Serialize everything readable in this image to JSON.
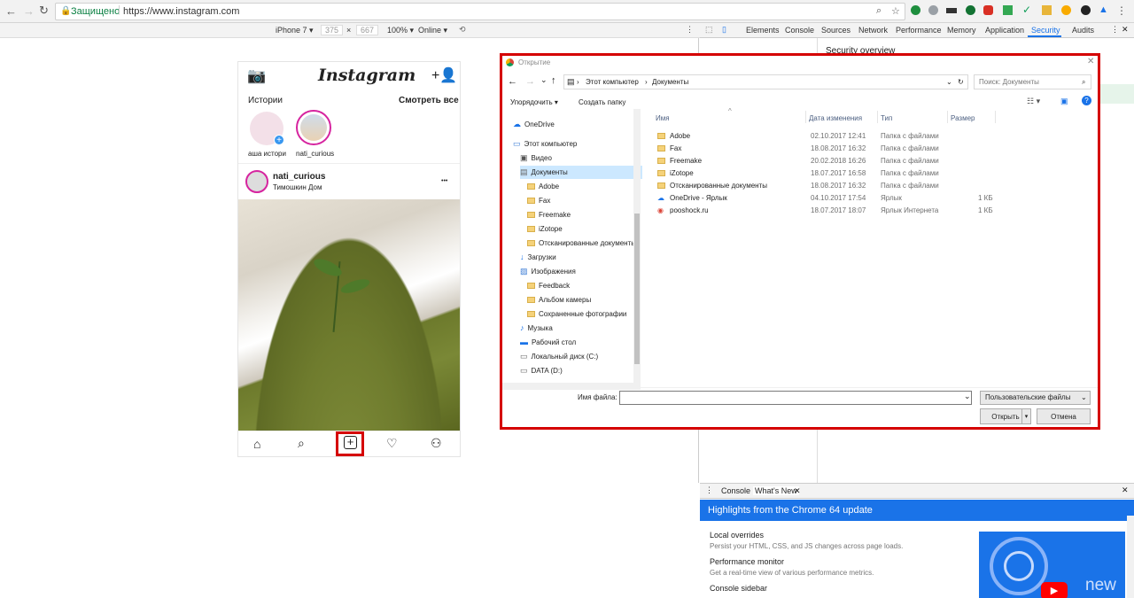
{
  "browser": {
    "secure_label": "Защищено",
    "url": "https://www.instagram.com"
  },
  "device_toolbar": {
    "device": "iPhone 7 ▾",
    "width": "375",
    "times": "×",
    "height": "667",
    "zoom": "100% ▾",
    "network": "Online ▾"
  },
  "devtools": {
    "tabs": [
      "Elements",
      "Console",
      "Sources",
      "Network",
      "Performance",
      "Memory",
      "Application",
      "Security",
      "Audits"
    ],
    "active_tab": "Security",
    "security_overview": "Security overview",
    "drawer_tabs": [
      "Console",
      "What's New"
    ],
    "highlights_title": "Highlights from the Chrome 64 update",
    "items": [
      {
        "title": "Local overrides",
        "desc": "Persist your HTML, CSS, and JS changes across page loads."
      },
      {
        "title": "Performance monitor",
        "desc": "Get a real-time view of various performance metrics."
      },
      {
        "title": "Console sidebar",
        "desc": ""
      }
    ],
    "video_label": "new"
  },
  "instagram": {
    "logo": "Instagram",
    "stories_label": "Истории",
    "watch_all": "Смотреть все",
    "stories": [
      {
        "name": "аша истори"
      },
      {
        "name": "nati_curious"
      }
    ],
    "post_user": "nati_curious",
    "post_location": "Тимошкин Дом",
    "more": "•••"
  },
  "dialog": {
    "title": "Открытие",
    "breadcrumb": [
      "Этот компьютер",
      "Документы"
    ],
    "search_placeholder": "Поиск: Документы",
    "organize": "Упорядочить ▾",
    "new_folder": "Создать папку",
    "columns": {
      "name": "Имя",
      "date": "Дата изменения",
      "type": "Тип",
      "size": "Размер"
    },
    "nav_items": [
      {
        "label": "OneDrive",
        "indent": 0,
        "kind": "cloud"
      },
      {
        "label": "Этот компьютер",
        "indent": 0,
        "kind": "pc"
      },
      {
        "label": "Видео",
        "indent": 1,
        "kind": "video"
      },
      {
        "label": "Документы",
        "indent": 1,
        "kind": "docs",
        "selected": true
      },
      {
        "label": "Adobe",
        "indent": 2,
        "kind": "folder"
      },
      {
        "label": "Fax",
        "indent": 2,
        "kind": "folder"
      },
      {
        "label": "Freemake",
        "indent": 2,
        "kind": "folder"
      },
      {
        "label": "iZotope",
        "indent": 2,
        "kind": "folder"
      },
      {
        "label": "Отсканированные документы",
        "indent": 2,
        "kind": "folder"
      },
      {
        "label": "Загрузки",
        "indent": 1,
        "kind": "down"
      },
      {
        "label": "Изображения",
        "indent": 1,
        "kind": "img"
      },
      {
        "label": "Feedback",
        "indent": 2,
        "kind": "folder"
      },
      {
        "label": "Альбом камеры",
        "indent": 2,
        "kind": "folder"
      },
      {
        "label": "Сохраненные фотографии",
        "indent": 2,
        "kind": "folder"
      },
      {
        "label": "Музыка",
        "indent": 1,
        "kind": "music"
      },
      {
        "label": "Рабочий стол",
        "indent": 1,
        "kind": "desktop"
      },
      {
        "label": "Локальный диск (C:)",
        "indent": 1,
        "kind": "disk"
      },
      {
        "label": "DATA (D:)",
        "indent": 1,
        "kind": "disk"
      }
    ],
    "files": [
      {
        "name": "Adobe",
        "date": "02.10.2017 12:41",
        "type": "Папка с файлами",
        "size": "",
        "kind": "folder"
      },
      {
        "name": "Fax",
        "date": "18.08.2017 16:32",
        "type": "Папка с файлами",
        "size": "",
        "kind": "folder"
      },
      {
        "name": "Freemake",
        "date": "20.02.2018 16:26",
        "type": "Папка с файлами",
        "size": "",
        "kind": "folder"
      },
      {
        "name": "iZotope",
        "date": "18.07.2017 16:58",
        "type": "Папка с файлами",
        "size": "",
        "kind": "folder"
      },
      {
        "name": "Отсканированные документы",
        "date": "18.08.2017 16:32",
        "type": "Папка с файлами",
        "size": "",
        "kind": "folder"
      },
      {
        "name": "OneDrive - Ярлык",
        "date": "04.10.2017 17:54",
        "type": "Ярлык",
        "size": "1 КБ",
        "kind": "cloud"
      },
      {
        "name": "pooshock.ru",
        "date": "18.07.2017 18:07",
        "type": "Ярлык Интернета",
        "size": "1 КБ",
        "kind": "web"
      }
    ],
    "filename_label": "Имя файла:",
    "filter": "Пользовательские файлы",
    "open": "Открыть",
    "cancel": "Отмена"
  }
}
